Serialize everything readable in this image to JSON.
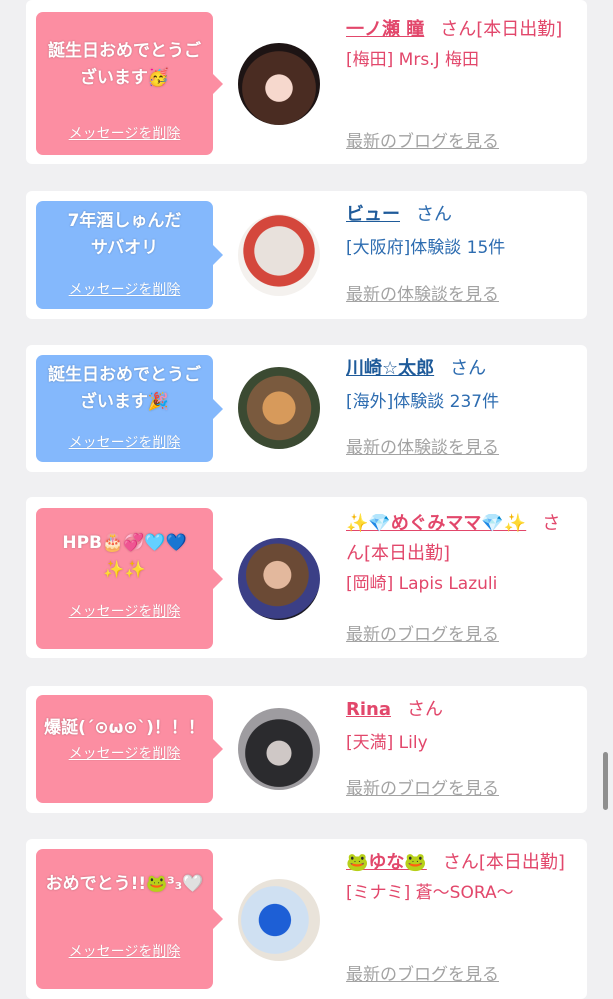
{
  "delete_label": "メッセージを削除",
  "cards": [
    {
      "message": "誕生日おめでとうございます🥳",
      "bubble_color": "pink",
      "name": "一ノ瀬 瞳",
      "san": "さん[本日出勤]",
      "shop": "[梅田] Mrs.J 梅田",
      "link": "最新のブログを見る"
    },
    {
      "message": "7年酒しゅんだ　　　サバオリ",
      "bubble_color": "blue",
      "name": "ビュー",
      "san": "さん",
      "shop": "[大阪府]体験談 15件",
      "link": "最新の体験談を見る"
    },
    {
      "message": "誕生日おめでとうございます🎉",
      "bubble_color": "blue",
      "name": "川崎☆太郎",
      "san": "さん",
      "shop": "[海外]体験談 237件",
      "link": "最新の体験談を見る"
    },
    {
      "message": "HPB🎂💞🩵💙✨✨",
      "bubble_color": "pink",
      "name": "✨💎めぐみママ💎✨",
      "san": "さん[本日出勤]",
      "shop": "[岡崎] Lapis Lazuli",
      "link": "最新のブログを見る"
    },
    {
      "message": "爆誕(´⊙ω⊙`)！！！",
      "bubble_color": "pink",
      "name": "Rina",
      "san": "さん",
      "shop": "[天満] Lily",
      "link": "最新のブログを見る"
    },
    {
      "message": "おめでとう!!🐸³₃🤍",
      "bubble_color": "pink",
      "name": "🐸ゆな🐸",
      "san": "さん[本日出勤]",
      "shop": "[ミナミ] 蒼〜SORA〜",
      "link": "最新のブログを見る"
    }
  ],
  "colors": {
    "pink_bubble": "#fc8ea2",
    "blue_bubble": "#84b8fc",
    "pink_text": "#e2476b",
    "blue_text": "#2d6cb0",
    "muted_link": "#a3a3a3",
    "background": "#f0f0f2"
  }
}
